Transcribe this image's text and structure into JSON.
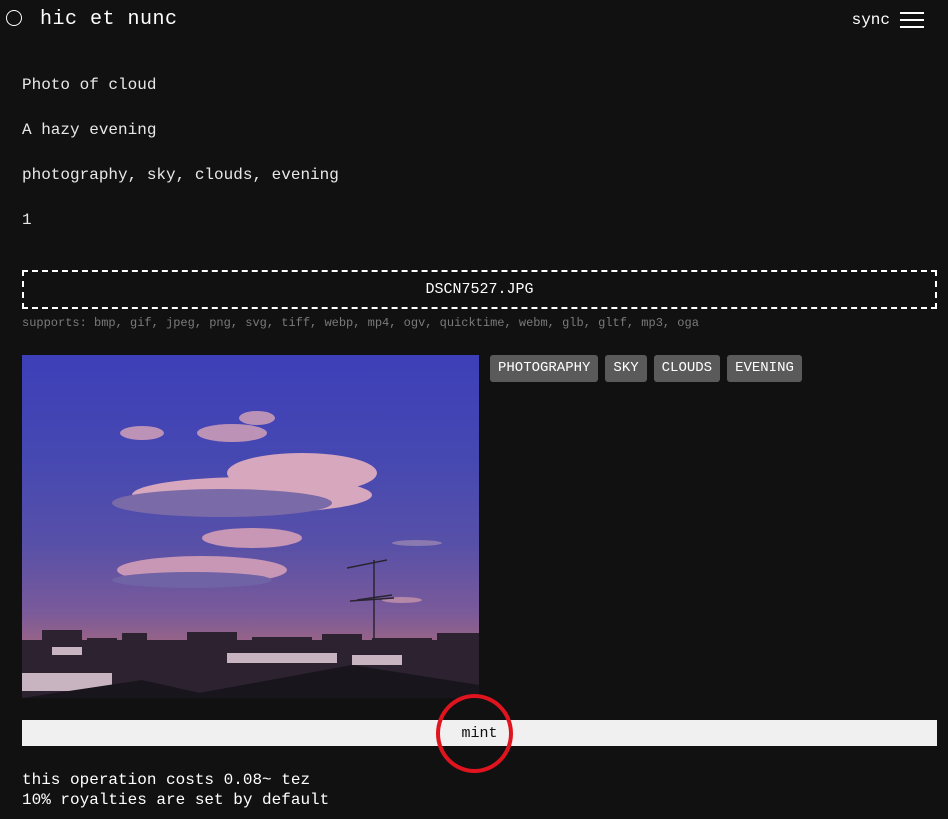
{
  "header": {
    "logo_text": "hic et nunc",
    "sync_label": "sync"
  },
  "form": {
    "title": "Photo of cloud",
    "description": "A hazy evening",
    "tags_input": "photography, sky, clouds, evening",
    "editions": "1"
  },
  "upload": {
    "file_name": "DSCN7527.JPG",
    "supports": "supports: bmp, gif, jpeg, png, svg, tiff, webp, mp4, ogv, quicktime, webm, glb, gltf, mp3, oga"
  },
  "tags": [
    "PHOTOGRAPHY",
    "SKY",
    "CLOUDS",
    "EVENING"
  ],
  "mint_label": "mint",
  "cost_line": "this operation costs 0.08~ tez",
  "royalties_line": "10% royalties are set by default",
  "colors": {
    "background": "#111111",
    "tag_bg": "#5a5a5a",
    "mint_bg": "#f0f0f0",
    "annotation": "#e0141e"
  }
}
